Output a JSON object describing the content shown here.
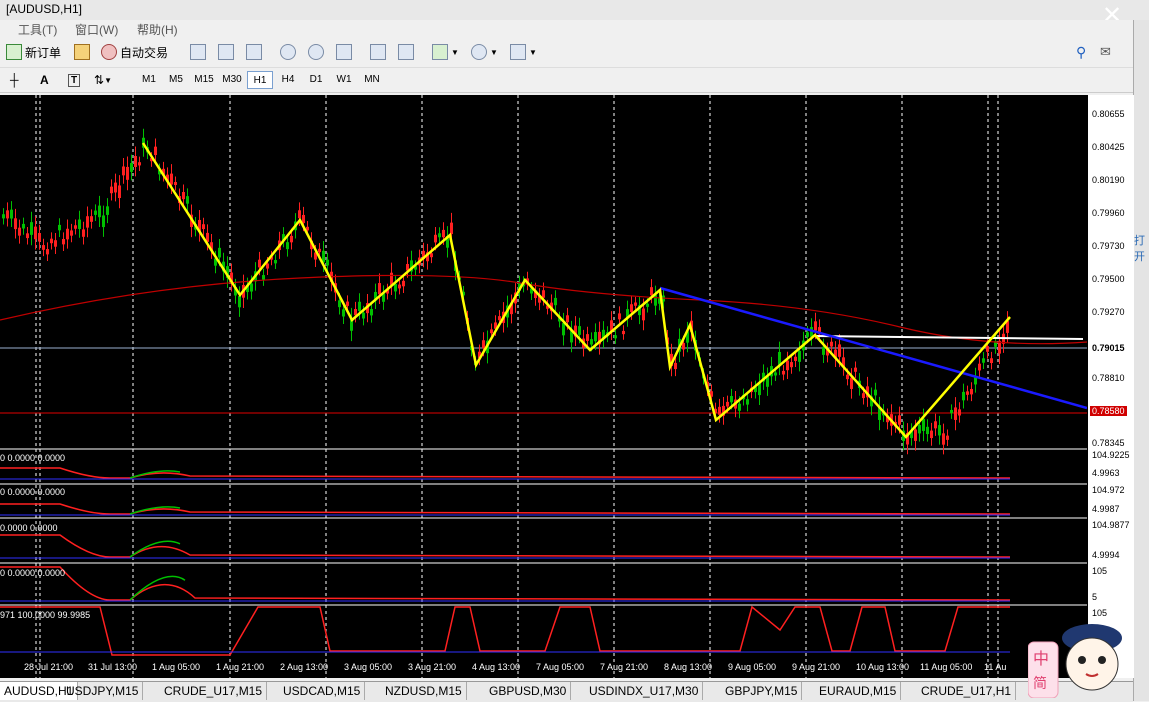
{
  "window": {
    "title": "[AUDUSD,H1]"
  },
  "menu": [
    "工具(T)",
    "窗口(W)",
    "帮助(H)"
  ],
  "toolbar": {
    "new_order": "新订单",
    "auto_trade": "自动交易"
  },
  "timeframes": [
    "M1",
    "M5",
    "M15",
    "M30",
    "H1",
    "H4",
    "D1",
    "W1",
    "MN"
  ],
  "active_timeframe": "H1",
  "side_text": "打开",
  "price_axis": [
    "0.80655",
    "0.80425",
    "0.80190",
    "0.79960",
    "0.79730",
    "0.79500",
    "0.79270",
    "0.79015",
    "0.78810",
    "0.78345"
  ],
  "current_price": "0.79015",
  "red_level_label": "0.78580",
  "indicators": [
    {
      "label": "0 0.0000 0.0000",
      "scale_top": "104.9225",
      "scale_bottom": "4.9963"
    },
    {
      "label": "0 0.0000 0.0000",
      "scale_top": "104.972",
      "scale_bottom": "4.9987"
    },
    {
      "label": "0.0000 0.0000",
      "scale_top": "104.9877",
      "scale_bottom": "4.9994"
    },
    {
      "label": "0 0.0000 0.0000",
      "scale_top": "105",
      "scale_bottom": "5"
    },
    {
      "label": "971 100.0000 99.9985",
      "scale_top": "105",
      "scale_bottom": ""
    }
  ],
  "time_labels": [
    "28 Jul 21:00",
    "31 Jul 13:00",
    "1 Aug 05:00",
    "1 Aug 21:00",
    "2 Aug 13:00",
    "3 Aug 05:00",
    "3 Aug 21:00",
    "4 Aug 13:00",
    "7 Aug 05:00",
    "7 Aug 21:00",
    "8 Aug 13:00",
    "9 Aug 05:00",
    "9 Aug 21:00",
    "10 Aug 13:00",
    "11 Aug 05:00",
    "11 Au"
  ],
  "tabs": [
    "AUDUSD,H1",
    "USDJPY,M15",
    "CRUDE_U17,M15",
    "USDCAD,M15",
    "NZDUSD,M15",
    "GBPUSD,M30",
    "USDINDX_U17,M30",
    "GBPJPY,M15",
    "EURAUD,M15",
    "CRUDE_U17,H1"
  ],
  "active_tab": "AUDUSD,H1",
  "colors": {
    "background": "#000000",
    "candle_up": "#00c000",
    "candle_down": "#ff2020",
    "zigzag": "#ffff00",
    "trendline": "#1a1aff",
    "ma": "#c00000",
    "current_line": "#ffffff"
  }
}
